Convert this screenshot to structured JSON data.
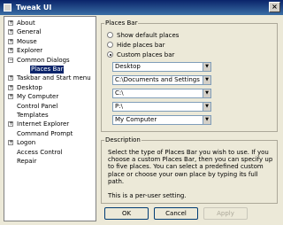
{
  "window": {
    "title": "Tweak UI",
    "close_label": "×"
  },
  "tree": {
    "items": [
      {
        "label": "About",
        "expander": "+"
      },
      {
        "label": "General",
        "expander": "+"
      },
      {
        "label": "Mouse",
        "expander": "+"
      },
      {
        "label": "Explorer",
        "expander": "+"
      },
      {
        "label": "Common Dialogs",
        "expander": "−"
      },
      {
        "label": "Places Bar",
        "expander": ""
      },
      {
        "label": "Taskbar and Start menu",
        "expander": "+"
      },
      {
        "label": "Desktop",
        "expander": "+"
      },
      {
        "label": "My Computer",
        "expander": "+"
      },
      {
        "label": "Control Panel",
        "expander": ""
      },
      {
        "label": "Templates",
        "expander": ""
      },
      {
        "label": "Internet Explorer",
        "expander": "+"
      },
      {
        "label": "Command Prompt",
        "expander": ""
      },
      {
        "label": "Logon",
        "expander": "+"
      },
      {
        "label": "Access Control",
        "expander": ""
      },
      {
        "label": "Repair",
        "expander": ""
      }
    ]
  },
  "places_bar": {
    "legend": "Places Bar",
    "options": [
      {
        "label": "Show default places",
        "checked": false
      },
      {
        "label": "Hide places bar",
        "checked": false
      },
      {
        "label": "Custom places bar",
        "checked": true
      }
    ],
    "combos": [
      "Desktop",
      "C:\\Documents and Settings\\%USER",
      "C:\\",
      "P:\\",
      "My Computer"
    ]
  },
  "description": {
    "legend": "Description",
    "text1": "Select the type of Places Bar you wish to use.  If you choose a custom Places Bar, then you can specify up to five places. You can select a predefined custom place or choose your own place by typing its full path.",
    "text2": "This is a per-user setting."
  },
  "buttons": {
    "ok": "OK",
    "cancel": "Cancel",
    "apply": "Apply"
  }
}
